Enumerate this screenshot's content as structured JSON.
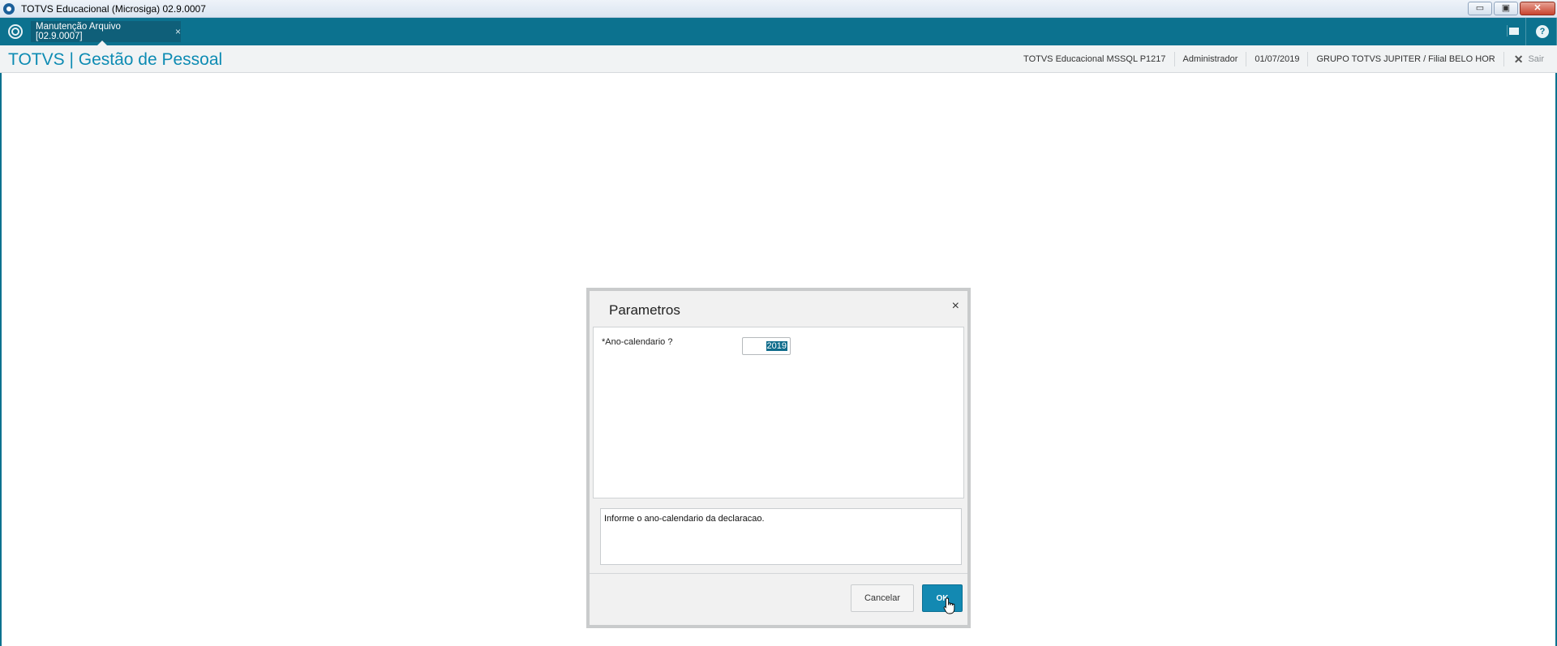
{
  "window": {
    "title": "TOTVS Educacional (Microsiga) 02.9.0007",
    "controls": {
      "minimize": "▭",
      "restore": "▣",
      "close": "✕"
    }
  },
  "tabbar": {
    "active_tab": {
      "label": "Manutenção Arquivo [02.9.0007]",
      "close": "×"
    },
    "help": "?"
  },
  "header": {
    "brand": "TOTVS | Gestão de Pessoal",
    "environment": "TOTVS Educacional MSSQL P1217",
    "user": "Administrador",
    "date": "01/07/2019",
    "company": "GRUPO TOTVS JUPITER / Filial BELO HOR",
    "exit_label": "Sair",
    "exit_icon": "✕"
  },
  "dialog": {
    "title": "Parametros",
    "close": "×",
    "params": [
      {
        "label": "*Ano-calendario ?",
        "value": "2019"
      }
    ],
    "help_text": "Informe o ano-calendario da declaracao.",
    "buttons": {
      "cancel": "Cancelar",
      "ok": "OK"
    }
  },
  "colors": {
    "teal_bar": "#0c728f",
    "brand": "#0d8bb3",
    "ok_button": "#1389b2"
  }
}
